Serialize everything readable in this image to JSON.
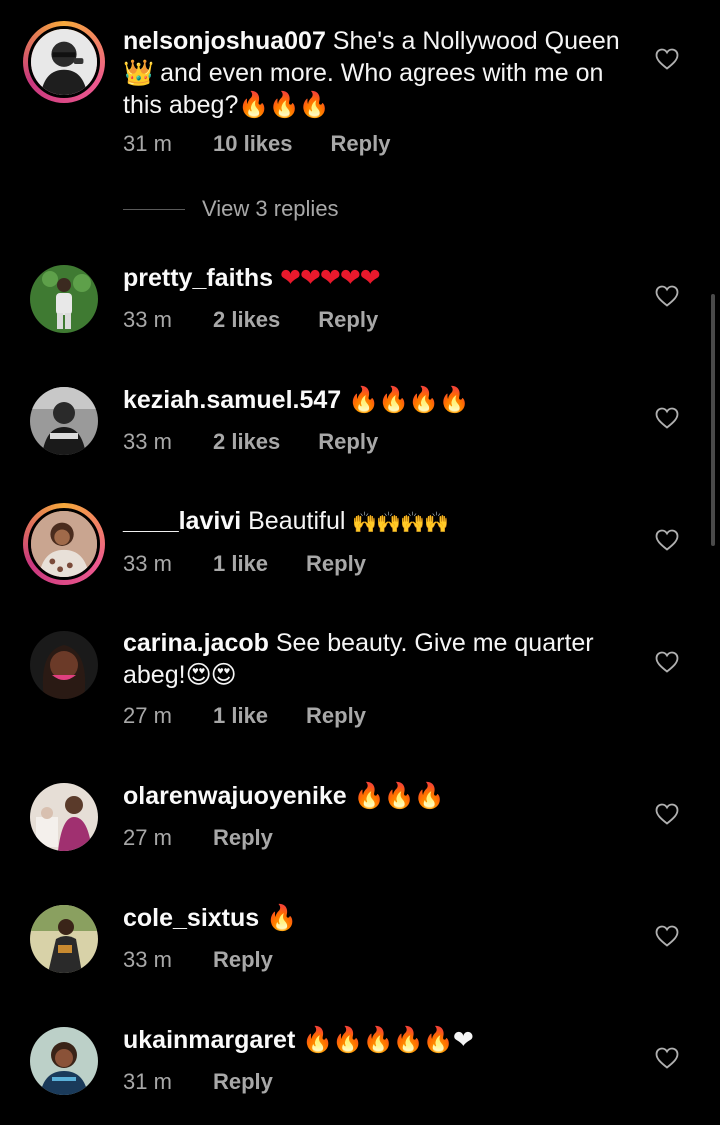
{
  "comments": [
    {
      "username": "nelsonjoshua007",
      "text_a": " She's a Nollywood Queen",
      "text_b": "👑",
      "text_c": " and even more. Who agrees with me on this abeg?",
      "text_d": "🔥🔥🔥",
      "time": "31 m",
      "likes": "10 likes",
      "reply": "Reply",
      "view_replies": "View 3 replies"
    },
    {
      "username": "pretty_faiths",
      "text": " ❤❤❤❤❤",
      "time": "33 m",
      "likes": "2 likes",
      "reply": "Reply"
    },
    {
      "username": "keziah.samuel.547",
      "text": " 🔥🔥🔥🔥",
      "time": "33 m",
      "likes": "2 likes",
      "reply": "Reply"
    },
    {
      "username": "____lavivi",
      "text": " Beautiful ",
      "emoji": "🙌🙌🙌🙌",
      "time": "33 m",
      "likes": "1 like",
      "reply": "Reply"
    },
    {
      "username": "carina.jacob",
      "text": " See beauty. Give me quarter abeg!",
      "emoji": "😍😍",
      "time": "27 m",
      "likes": "1 like",
      "reply": "Reply"
    },
    {
      "username": "olarenwajuoyenike",
      "text": " 🔥🔥🔥",
      "time": "27 m",
      "reply": "Reply"
    },
    {
      "username": "cole_sixtus",
      "text": " 🔥",
      "time": "33 m",
      "reply": "Reply"
    },
    {
      "username": "ukainmargaret",
      "text": " 🔥🔥🔥🔥🔥❤",
      "time": "31 m",
      "reply": "Reply"
    }
  ],
  "icons": {
    "like": "heart-outline-icon"
  },
  "colors": {
    "background": "#000000",
    "username": "#fafafa",
    "meta": "#a8a8a8"
  }
}
